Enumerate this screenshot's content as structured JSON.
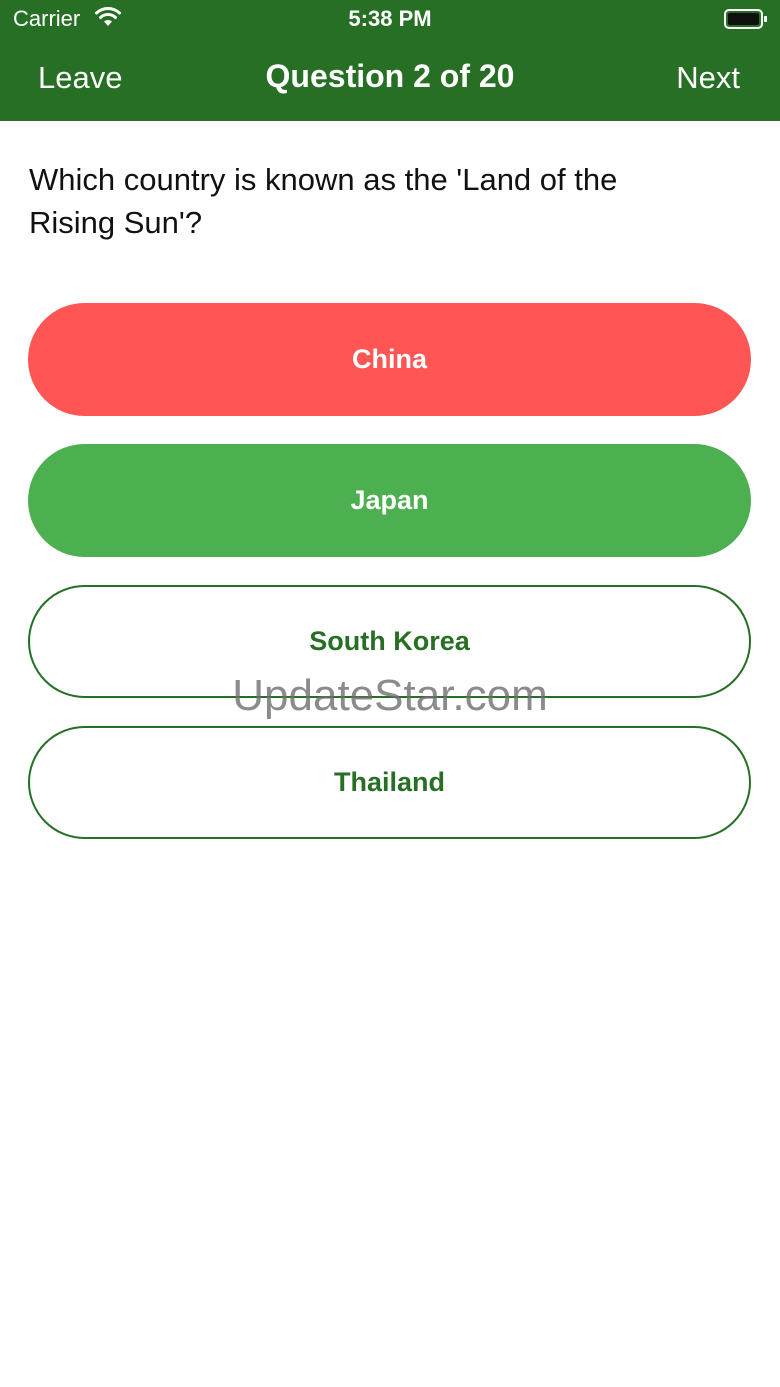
{
  "status_bar": {
    "carrier": "Carrier",
    "time": "5:38 PM",
    "wifi_icon": "wifi-icon",
    "battery_icon": "battery-icon"
  },
  "nav": {
    "left": "Leave",
    "title": "Question 2 of 20",
    "right": "Next"
  },
  "question": "Which country is known as the 'Land of the Rising Sun'?",
  "answers": [
    {
      "label": "China",
      "state": "wrong"
    },
    {
      "label": "Japan",
      "state": "correct"
    },
    {
      "label": "South Korea",
      "state": "neutral"
    },
    {
      "label": "Thailand",
      "state": "neutral"
    }
  ],
  "watermark": "UpdateStar.com",
  "colors": {
    "primary": "#276f25",
    "wrong": "#ff5555",
    "correct": "#4caf50"
  }
}
